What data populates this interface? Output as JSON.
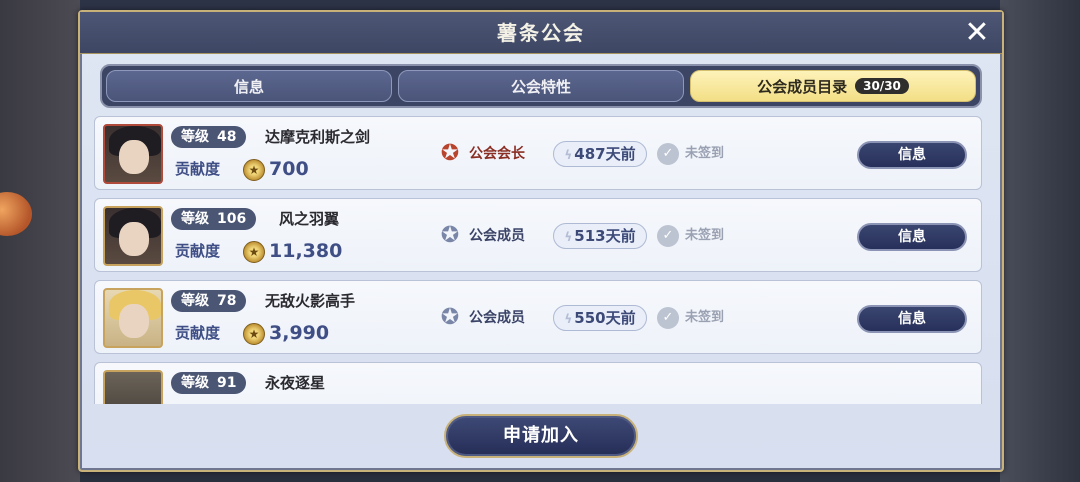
{
  "dialog": {
    "title": "薯条公会",
    "close_icon": "✕"
  },
  "tabs": [
    {
      "label": "信息",
      "active": false,
      "count": ""
    },
    {
      "label": "公会特性",
      "active": false,
      "count": ""
    },
    {
      "label": "公会成员目录",
      "active": true,
      "count": "30/30"
    }
  ],
  "members": [
    {
      "level_label": "等级",
      "level": "48",
      "name": "达摩克利斯之剑",
      "contrib_label": "贡献度",
      "contrib": "700",
      "role": "公会会长",
      "role_type": "leader",
      "last_seen": "487天前",
      "checkin": "未签到",
      "button": "信息",
      "avatar": "dark"
    },
    {
      "level_label": "等级",
      "level": "106",
      "name": "风之羽翼",
      "contrib_label": "贡献度",
      "contrib": "11,380",
      "role": "公会成员",
      "role_type": "member",
      "last_seen": "513天前",
      "checkin": "未签到",
      "button": "信息",
      "avatar": "dark"
    },
    {
      "level_label": "等级",
      "level": "78",
      "name": "无敌火影高手",
      "contrib_label": "贡献度",
      "contrib": "3,990",
      "role": "公会成员",
      "role_type": "member",
      "last_seen": "550天前",
      "checkin": "未签到",
      "button": "信息",
      "avatar": "blonde"
    },
    {
      "level_label": "等级",
      "level": "91",
      "name": "永夜逐星",
      "contrib_label": "",
      "contrib": "",
      "role": "",
      "role_type": "member",
      "last_seen": "",
      "checkin": "",
      "button": "",
      "avatar": "unknown"
    }
  ],
  "footer": {
    "join_label": "申请加入"
  }
}
